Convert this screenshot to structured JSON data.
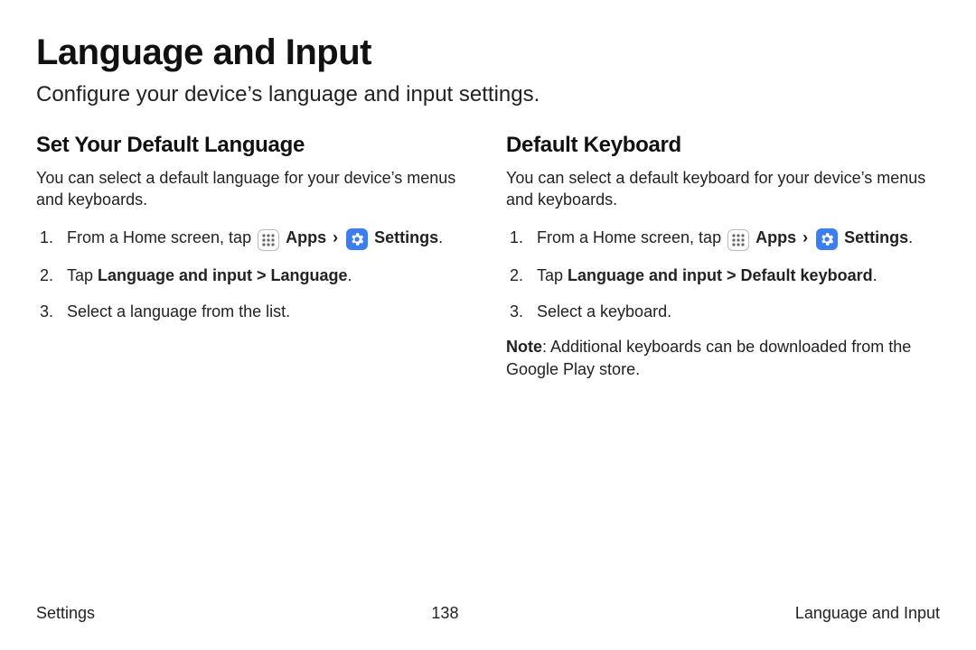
{
  "page": {
    "title": "Language and Input",
    "subtitle": "Configure your device’s language and input settings."
  },
  "icons": {
    "apps_label": "Apps",
    "settings_label": "Settings"
  },
  "left": {
    "heading": "Set Your Default Language",
    "intro": "You can select a default language for your device’s menus and keyboards.",
    "step1_prefix": "From a Home screen, tap ",
    "step2_prefix": "Tap ",
    "step2_bold": "Language and input > Language",
    "step3": "Select a language from the list."
  },
  "right": {
    "heading": "Default Keyboard",
    "intro": "You can select a default keyboard for your device’s menus and keyboards.",
    "step1_prefix": "From a Home screen, tap ",
    "step2_prefix": "Tap ",
    "step2_bold": "Language and input > Default keyboard",
    "step3": "Select a keyboard.",
    "note_label": "Note",
    "note_body": ": Additional keyboards can be downloaded from the Google Play store."
  },
  "footer": {
    "left": "Settings",
    "center": "138",
    "right": "Language and Input"
  }
}
